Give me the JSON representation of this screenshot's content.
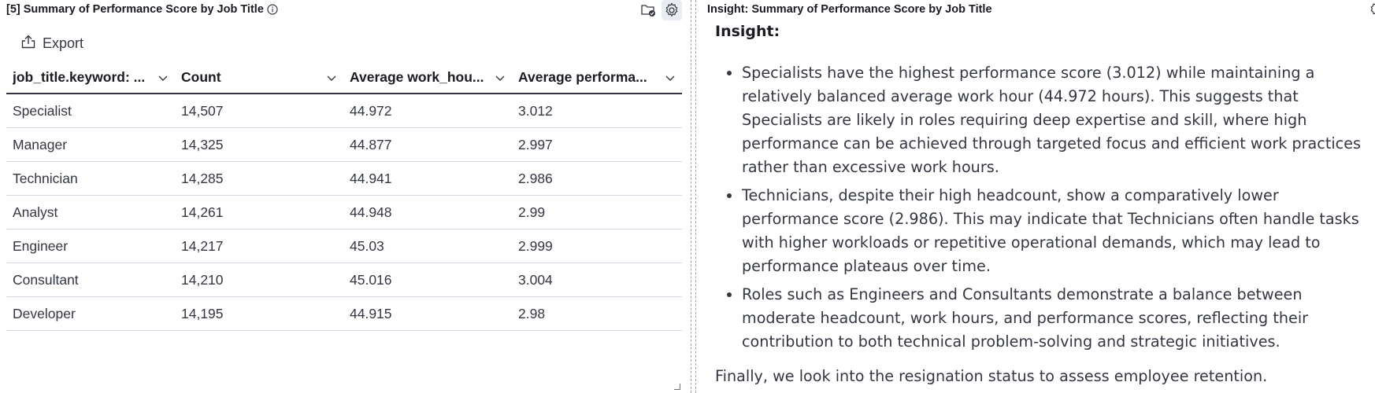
{
  "left_panel": {
    "title": "[5] Summary of Performance Score by Job Title",
    "export_label": "Export",
    "columns": [
      {
        "label": "job_title.keyword: ..."
      },
      {
        "label": "Count"
      },
      {
        "label": "Average work_hou..."
      },
      {
        "label": "Average performa..."
      }
    ],
    "rows": [
      {
        "job_title": "Specialist",
        "count": "14,507",
        "avg_work_hours": "44.972",
        "avg_performance": "3.012"
      },
      {
        "job_title": "Manager",
        "count": "14,325",
        "avg_work_hours": "44.877",
        "avg_performance": "2.997"
      },
      {
        "job_title": "Technician",
        "count": "14,285",
        "avg_work_hours": "44.941",
        "avg_performance": "2.986"
      },
      {
        "job_title": "Analyst",
        "count": "14,261",
        "avg_work_hours": "44.948",
        "avg_performance": "2.99"
      },
      {
        "job_title": "Engineer",
        "count": "14,217",
        "avg_work_hours": "45.03",
        "avg_performance": "2.999"
      },
      {
        "job_title": "Consultant",
        "count": "14,210",
        "avg_work_hours": "45.016",
        "avg_performance": "3.004"
      },
      {
        "job_title": "Developer",
        "count": "14,195",
        "avg_work_hours": "44.915",
        "avg_performance": "2.98"
      }
    ]
  },
  "right_panel": {
    "title": "Insight: Summary of Performance Score by Job Title",
    "heading": "Insight:",
    "bullets": [
      "Specialists have the highest performance score (3.012) while maintaining a relatively balanced average work hour (44.972 hours). This suggests that Specialists are likely in roles requiring deep expertise and skill, where high performance can be achieved through targeted focus and efficient work practices rather than excessive work hours.",
      "Technicians, despite their high headcount, show a comparatively lower performance score (2.986). This may indicate that Technicians often handle tasks with higher workloads or repetitive operational demands, which may lead to performance plateaus over time.",
      "Roles such as Engineers and Consultants demonstrate a balance between moderate headcount, work hours, and performance scores, reflecting their contribution to both technical problem-solving and strategic initiatives."
    ],
    "footer": "Finally, we look into the resignation status to assess employee retention."
  },
  "icons": {
    "info": "info-icon",
    "inspect": "inspect-icon",
    "settings": "gear-icon",
    "export": "share-icon",
    "sort": "chevron-down-icon"
  }
}
